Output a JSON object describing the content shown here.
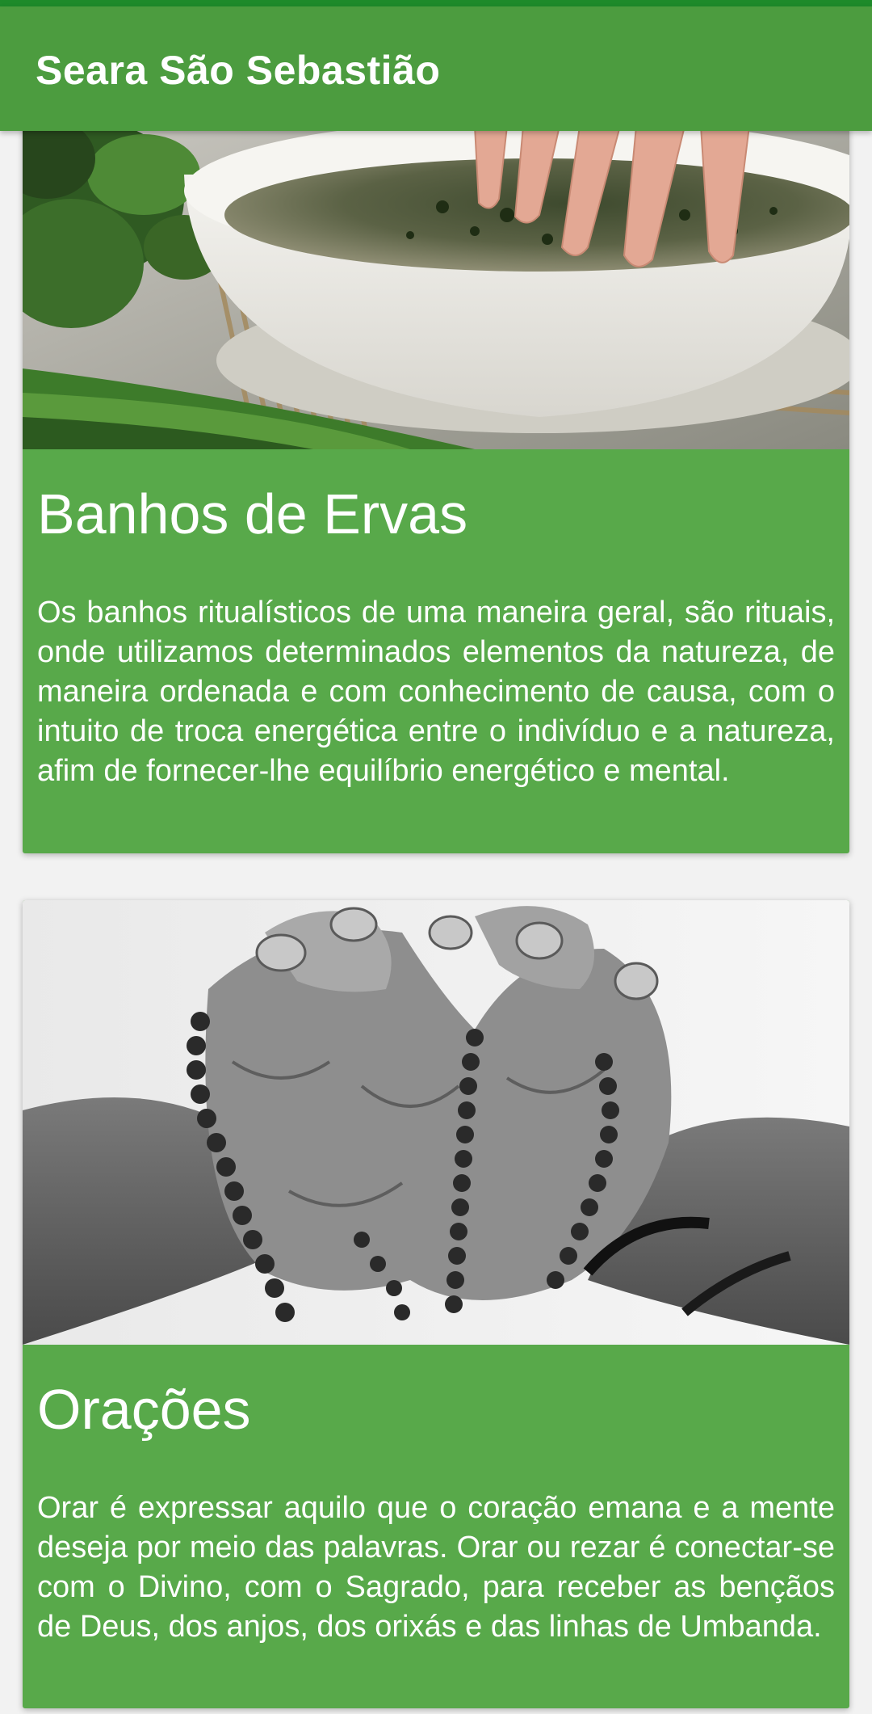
{
  "app_bar": {
    "title": "Seara São Sebastião"
  },
  "cards": [
    {
      "title": "Banhos de Ervas",
      "description": "Os banhos ritualísticos de uma maneira geral, são rituais, onde utilizamos determinados elementos da natureza, de maneira ordenada e com conhecimento de causa, com o intuito de troca energética entre o indivíduo e a natureza, afim de fornecer-lhe equilíbrio energético e mental.",
      "image": "herbal-bath-photo"
    },
    {
      "title": "Orações",
      "description": "Orar é expressar aquilo que o coração emana e a mente deseja por meio das palavras. Orar ou rezar é conectar-se com o Divino, com o Sagrado, para receber as bençãos de Deus, dos anjos, dos orixás e das linhas de Umbanda.",
      "image": "praying-hands-rosary-photo"
    }
  ],
  "colors": {
    "status_bar": "#1e8a2a",
    "app_bar": "#4c9c3f",
    "card_background": "#58a94a",
    "text": "#ffffff"
  }
}
